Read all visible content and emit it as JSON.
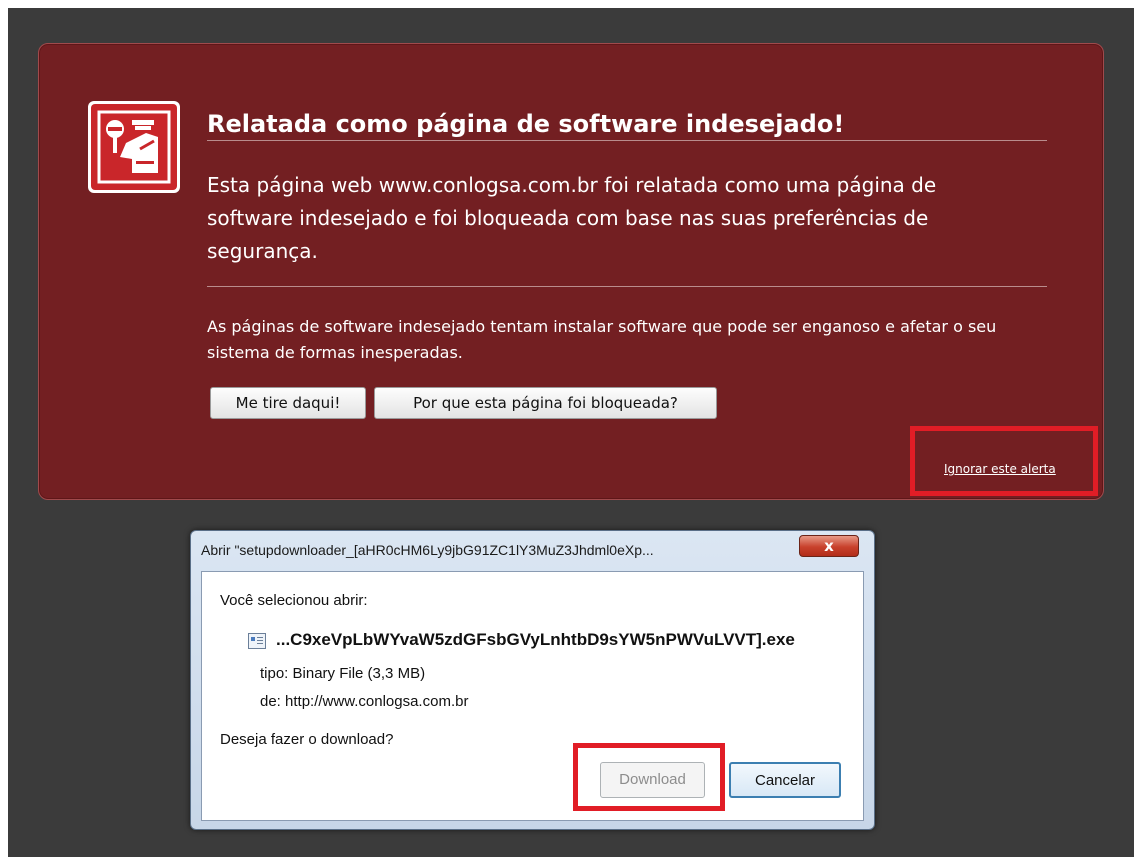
{
  "warning": {
    "title": "Relatada como página de software indesejado!",
    "description": "Esta página web www.conlogsa.com.br foi relatada como uma página de software indesejado e foi bloqueada com base nas suas preferências de segurança.",
    "explanation": "As páginas de software indesejado tentam instalar software que pode ser enganoso e afetar o seu sistema de formas inesperadas.",
    "button_get_me_out": "Me tire daqui!",
    "button_why_blocked": "Por que esta página foi bloqueada?",
    "ignore_link": "Ignorar este alerta",
    "icon": "warning-shield-icon",
    "panel_color": "#731f22"
  },
  "dialog": {
    "title": "Abrir \"setupdownloader_[aHR0cHM6Ly9jbG91ZC1lY3MuZ3Jhdml0eXp...",
    "close_label": "x",
    "prompt": "Você selecionou abrir:",
    "filename": "...C9xeVpLbWYvaW5zdGFsbGVyLnhtbD9sYW5nPWVuLVVT].exe",
    "type_label": "tipo:",
    "type_value": "Binary File (3,3 MB)",
    "from_label": "de:",
    "from_value": "http://www.conlogsa.com.br",
    "question": "Deseja fazer o download?",
    "button_download": "Download",
    "button_cancel": "Cancelar",
    "file_icon": "executable-file-icon"
  },
  "highlight_color": "#e11d26"
}
